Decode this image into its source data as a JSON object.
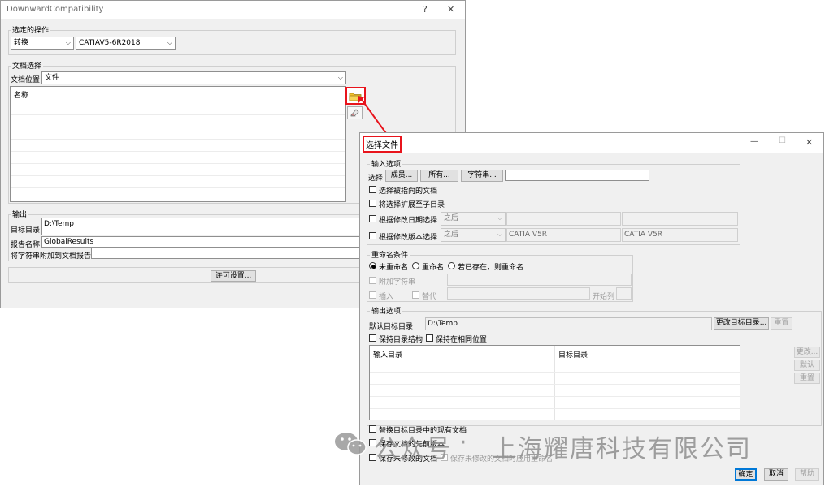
{
  "main_window": {
    "title": "DownwardCompatibility",
    "help_symbol": "?",
    "close_symbol": "✕",
    "operation_group": "选定的操作",
    "operation_value": "转换",
    "version_value": "CATIAV5-6R2018",
    "doc_group": "文档选择",
    "doc_location_label": "文档位置",
    "doc_location_value": "文件",
    "list_header": "名称",
    "output_group": "输出",
    "target_dir_label": "目标目录",
    "target_dir_value": "D:\\Temp",
    "report_label": "报告名称",
    "report_value": "GlobalResults",
    "append_label": "将字符串附加到文档报告",
    "license_button": "许可设置..."
  },
  "dialog": {
    "title": "选择文件",
    "minimize_symbol": "—",
    "maximize_symbol": "☐",
    "close_symbol": "✕",
    "input_group": "输入选项",
    "select_label": "选择",
    "members_button": "成员...",
    "all_button": "所有...",
    "string_button": "字符串...",
    "select_pointed": "选择被指向的文档",
    "extend_subdirs": "将选择扩展至子目录",
    "by_date": "根据修改日期选择",
    "date_combo": "之后",
    "by_version": "根据修改版本选择",
    "version_combo": "之后",
    "version_a": "CATIA V5R",
    "version_b": "CATIA V5R",
    "rename_group": "重命名条件",
    "no_rename": "未重命名",
    "rename": "重命名",
    "rename_if_exists": "若已存在，则重命名",
    "append_string": "附加字符串",
    "insert": "插入",
    "replace": "替代",
    "start_column": "开始列",
    "output_group": "输出选项",
    "default_target_label": "默认目标目录",
    "default_target_value": "D:\\Temp",
    "change_target_button": "更改目标目录...",
    "reset_button": "重置",
    "keep_structure": "保持目录结构",
    "keep_same_location": "保持在相同位置",
    "col_input_dir": "输入目录",
    "col_target_dir": "目标目录",
    "side_change": "更改...",
    "side_default": "默认",
    "side_reset": "重置",
    "replace_existing": "替换目标目录中的现有文档",
    "keep_previous_version": "保存文档的先前版本",
    "save_unmodified": "保存未修改的文档",
    "rename_unmodified": "保存未修改的文档时应用重命名",
    "ok_button": "确定",
    "cancel_button": "取消",
    "help_button": "帮助"
  },
  "watermark": {
    "prefix": "公众号",
    "dot": "·",
    "company": "上海耀唐科技有限公司"
  },
  "colors": {
    "highlight_red": "#e8141c",
    "folder_yellow": "#f2c230"
  }
}
